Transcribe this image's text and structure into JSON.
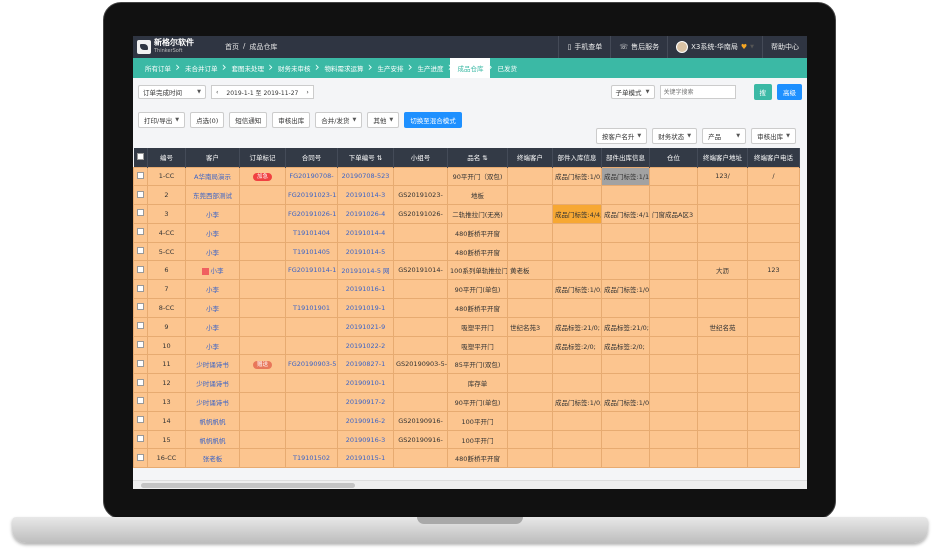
{
  "header": {
    "logo_name": "新格尔软件",
    "logo_sub": "ThinkerSoft",
    "breadcrumb_home": "首页",
    "breadcrumb_sep": "/",
    "breadcrumb_current": "成品仓库",
    "mobile_order": "手机查单",
    "after_sales": "售后服务",
    "user": "X3系统-华南局",
    "help": "帮助中心"
  },
  "flow": [
    "所有订单",
    "未合并订单",
    "套图未处理",
    "财务未审核",
    "物料需求运算",
    "生产安排",
    "生产进度",
    "成品仓库",
    "已发货"
  ],
  "flow_active_index": 7,
  "toolbar1": {
    "date_type": "订单完成时间",
    "date_range": "2019-1-1 至 2019-11-27",
    "mode": "子单模式",
    "search_placeholder": "关键字搜索",
    "search_btn": "搜",
    "advanced_btn": "高级"
  },
  "toolbar2": {
    "print": "打印/导出",
    "selected": "点选(0)",
    "sms": "短信通知",
    "audit_out": "审核出库",
    "merge_ship": "合并/发货",
    "other": "其他",
    "switch_mode": "切换至混合模式",
    "sort_client": "按客户名升",
    "finance_status": "财务状态",
    "product": "产品",
    "audit_out2": "审核出库"
  },
  "columns": [
    "编号",
    "客户",
    "订单标记",
    "合同号",
    "下单编号 ⇅",
    "小组号",
    "品名 ⇅",
    "终端客户",
    "部件入库信息",
    "部件出库信息",
    "仓位",
    "终端客户地址",
    "终端客户电话"
  ],
  "rows": [
    {
      "no": "1-CC",
      "client": "A华南局演示",
      "tag": "加急",
      "contract": "FG20190708-",
      "order": "20190708-523",
      "group": "",
      "product": "90平开门（双包)",
      "end_client": "",
      "in_info": "成品门标签:1/0;",
      "out_info": "成品门标签:1/1;",
      "pos": "",
      "addr": "123/",
      "phone": "/"
    },
    {
      "no": "2",
      "client": "东莞西部测试",
      "tag": "",
      "contract": "FG20191023-12",
      "order": "20191014-3",
      "group": "GS20191023-",
      "product": "地板",
      "end_client": "",
      "in_info": "",
      "out_info": "",
      "pos": "",
      "addr": "",
      "phone": ""
    },
    {
      "no": "3",
      "client": "小李",
      "tag": "",
      "contract": "FG20191026-17",
      "order": "20191026-4",
      "group": "GS20191026-",
      "product": "二轨推拉门(无亮)",
      "end_client": "",
      "in_info": "成品门标签:4/4;",
      "out_info": "成品门标签:4/1;",
      "pos": "门窗成品A区3",
      "addr": "",
      "phone": ""
    },
    {
      "no": "4-CC",
      "client": "小李",
      "tag": "",
      "contract": "T19101404",
      "order": "20191014-4",
      "group": "",
      "product": "480断桥平开窗",
      "end_client": "",
      "in_info": "",
      "out_info": "",
      "pos": "",
      "addr": "",
      "phone": ""
    },
    {
      "no": "5-CC",
      "client": "小李",
      "tag": "",
      "contract": "T19101405",
      "order": "20191014-5",
      "group": "",
      "product": "480断桥平开窗",
      "end_client": "",
      "in_info": "",
      "out_info": "",
      "pos": "",
      "addr": "",
      "phone": ""
    },
    {
      "no": "6",
      "client": "小李",
      "tag": "",
      "contract": "FG20191014-11",
      "order": "20191014-5 网",
      "group": "GS20191014-",
      "product": "100系列单轨推拉门",
      "end_client": "黄老板",
      "in_info": "",
      "out_info": "",
      "pos": "",
      "addr": "大沥",
      "phone": "123"
    },
    {
      "no": "7",
      "client": "小李",
      "tag": "",
      "contract": "",
      "order": "20191016-1",
      "group": "",
      "product": "90平开门(单包)",
      "end_client": "",
      "in_info": "成品门标签:1/0;",
      "out_info": "成品门标签:1/0;",
      "pos": "",
      "addr": "",
      "phone": ""
    },
    {
      "no": "8-CC",
      "client": "小李",
      "tag": "",
      "contract": "T19101901",
      "order": "20191019-1",
      "group": "",
      "product": "480断桥平开窗",
      "end_client": "",
      "in_info": "",
      "out_info": "",
      "pos": "",
      "addr": "",
      "phone": ""
    },
    {
      "no": "9",
      "client": "小李",
      "tag": "",
      "contract": "",
      "order": "20191021-9",
      "group": "",
      "product": "吸塑平开门",
      "end_client": "世纪名苑3",
      "in_info": "成品标签:21/0;",
      "out_info": "成品标签:21/0;",
      "pos": "",
      "addr": "世纪名苑",
      "phone": ""
    },
    {
      "no": "10",
      "client": "小李",
      "tag": "",
      "contract": "",
      "order": "20191022-2",
      "group": "",
      "product": "吸塑平开门",
      "end_client": "",
      "in_info": "成品标签:2/0;",
      "out_info": "成品标签:2/0;",
      "pos": "",
      "addr": "",
      "phone": ""
    },
    {
      "no": "11",
      "client": "少时诵诗书",
      "tag": "赠送",
      "contract": "FG20190903-5",
      "order": "20190827-1",
      "group": "GS20190903-5-",
      "product": "85平开门(双包)",
      "end_client": "",
      "in_info": "",
      "out_info": "",
      "pos": "",
      "addr": "",
      "phone": ""
    },
    {
      "no": "12",
      "client": "少时诵诗书",
      "tag": "",
      "contract": "",
      "order": "20190910-1",
      "group": "",
      "product": "库存单",
      "end_client": "",
      "in_info": "",
      "out_info": "",
      "pos": "",
      "addr": "",
      "phone": ""
    },
    {
      "no": "13",
      "client": "少时诵诗书",
      "tag": "",
      "contract": "",
      "order": "20190917-2",
      "group": "",
      "product": "90平开门(单包)",
      "end_client": "",
      "in_info": "成品门标签:1/0;",
      "out_info": "成品门标签:1/0;",
      "pos": "",
      "addr": "",
      "phone": ""
    },
    {
      "no": "14",
      "client": "帆帆帆帆",
      "tag": "",
      "contract": "",
      "order": "20190916-2",
      "group": "GS20190916-",
      "product": "100平开门",
      "end_client": "",
      "in_info": "",
      "out_info": "",
      "pos": "",
      "addr": "",
      "phone": ""
    },
    {
      "no": "15",
      "client": "帆帆帆帆",
      "tag": "",
      "contract": "",
      "order": "20190916-3",
      "group": "GS20190916-",
      "product": "100平开门",
      "end_client": "",
      "in_info": "",
      "out_info": "",
      "pos": "",
      "addr": "",
      "phone": ""
    },
    {
      "no": "16-CC",
      "client": "张老板",
      "tag": "",
      "contract": "T19101502",
      "order": "20191015-1",
      "group": "",
      "product": "480断桥平开窗",
      "end_client": "",
      "in_info": "",
      "out_info": "",
      "pos": "",
      "addr": "",
      "phone": ""
    }
  ],
  "colors": {
    "topbar": "#2f3542",
    "flow": "#3bb9a5",
    "row_bg": "#fcc58f",
    "link": "#3a63c7",
    "tag": "#f04141",
    "highlight_yellow": "#f7a833",
    "highlight_grey": "#a2a2a2"
  }
}
